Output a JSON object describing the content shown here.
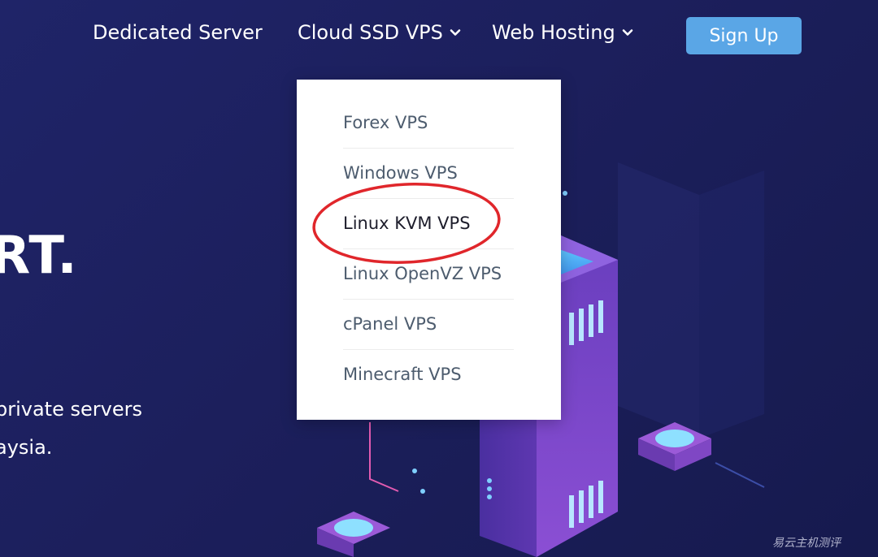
{
  "nav": {
    "items": [
      {
        "label": "Dedicated Server",
        "dropdown": false
      },
      {
        "label": "Cloud SSD VPS",
        "dropdown": true
      },
      {
        "label": "Web Hosting",
        "dropdown": true
      }
    ],
    "signup_label": "Sign Up"
  },
  "hero": {
    "title_fragment": "RT.",
    "line1": "private servers",
    "line2": "aysia."
  },
  "dropdown": {
    "items": [
      {
        "label": "Forex VPS"
      },
      {
        "label": "Windows VPS"
      },
      {
        "label": "Linux KVM VPS",
        "highlighted": true
      },
      {
        "label": "Linux OpenVZ VPS"
      },
      {
        "label": "cPanel VPS"
      },
      {
        "label": "Minecraft VPS"
      }
    ]
  },
  "watermark": "易云主机测评",
  "colors": {
    "background": "#1c1f5c",
    "signup_button": "#5aa6e6",
    "annotation_circle": "#e0262b",
    "dropdown_text": "#4d5c6e"
  },
  "icons": {
    "dropdown_caret": "chevron-down-icon"
  }
}
